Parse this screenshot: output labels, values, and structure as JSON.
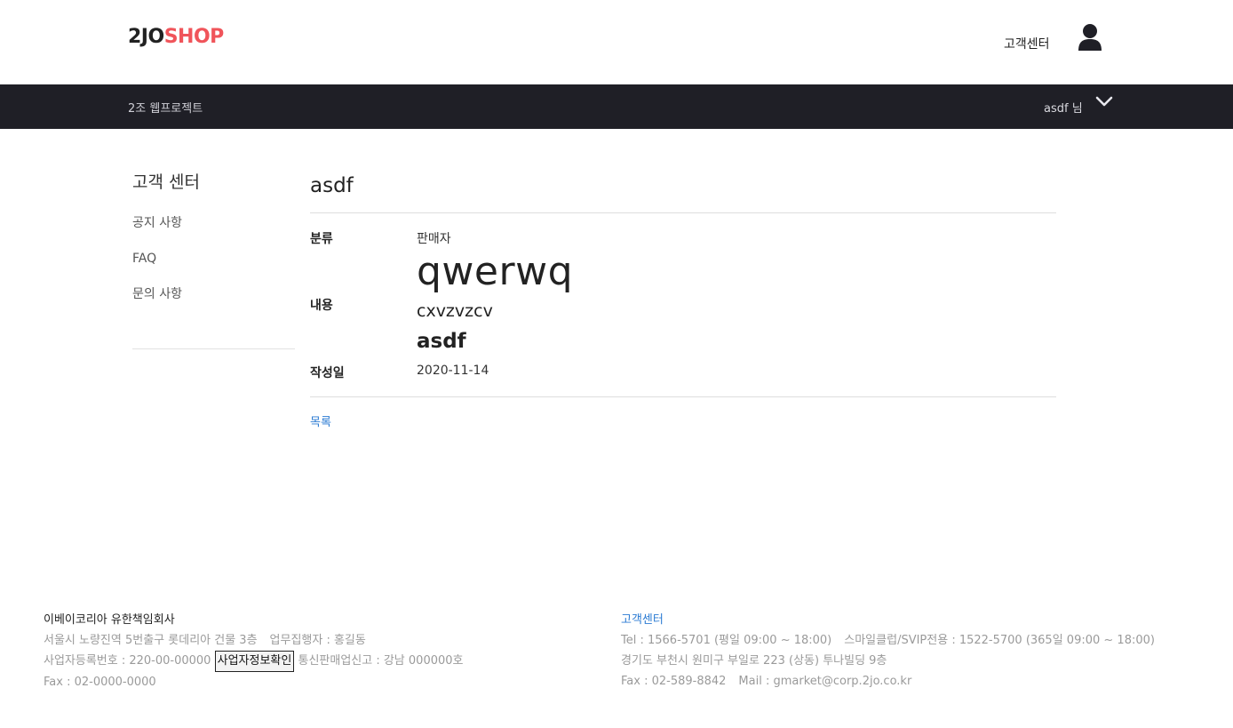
{
  "header": {
    "logo_main": "2JO",
    "logo_accent": "SHOP",
    "customer_center": "고객센터",
    "user_icon": "user-icon"
  },
  "navbar": {
    "title": "2조 웹프로젝트",
    "user_greeting": "asdf 님",
    "chevron_icon": "chevron-down-icon"
  },
  "sidebar": {
    "title": "고객 센터",
    "items": [
      {
        "label": "공지 사항"
      },
      {
        "label": "FAQ"
      },
      {
        "label": "문의 사항"
      }
    ]
  },
  "post": {
    "title": "asdf",
    "category_label": "분류",
    "category_value": "판매자",
    "content_label": "내용",
    "content_h1": "qwerwq",
    "content_h3": "cxvzvzcv",
    "content_h2": "asdf",
    "date_label": "작성일",
    "date_value": "2020-11-14",
    "list_link": "목록"
  },
  "footer": {
    "company": "이베이코리아 유한책임회사",
    "address": "서울시 노량진역 5번출구 롯데리아 건물 3층",
    "ceo": "업무집행자 : 홍길동",
    "biz_no": "사업자등록번호 : 220-00-00000",
    "biz_button": "사업자정보확인",
    "mail_order": "통신판매업신고 : 강남 000000호",
    "fax": "Fax : 02-0000-0000",
    "cs_title": "고객센터",
    "tel": "Tel : 1566-5701 (평일 09:00 ~ 18:00)",
    "vip_tel": "스마일클럽/SVIP전용 : 1522-5700 (365일 09:00 ~ 18:00)",
    "cs_address": "경기도 부천시 원미구 부일로 223 (상동) 투나빌딩 9층",
    "cs_fax": "Fax : 02-589-8842",
    "cs_mail": "Mail : gmarket@corp.2jo.co.kr"
  },
  "colors": {
    "accent": "#f0545a",
    "navbar_bg": "#1f1f26",
    "link": "#2b7bd3"
  }
}
